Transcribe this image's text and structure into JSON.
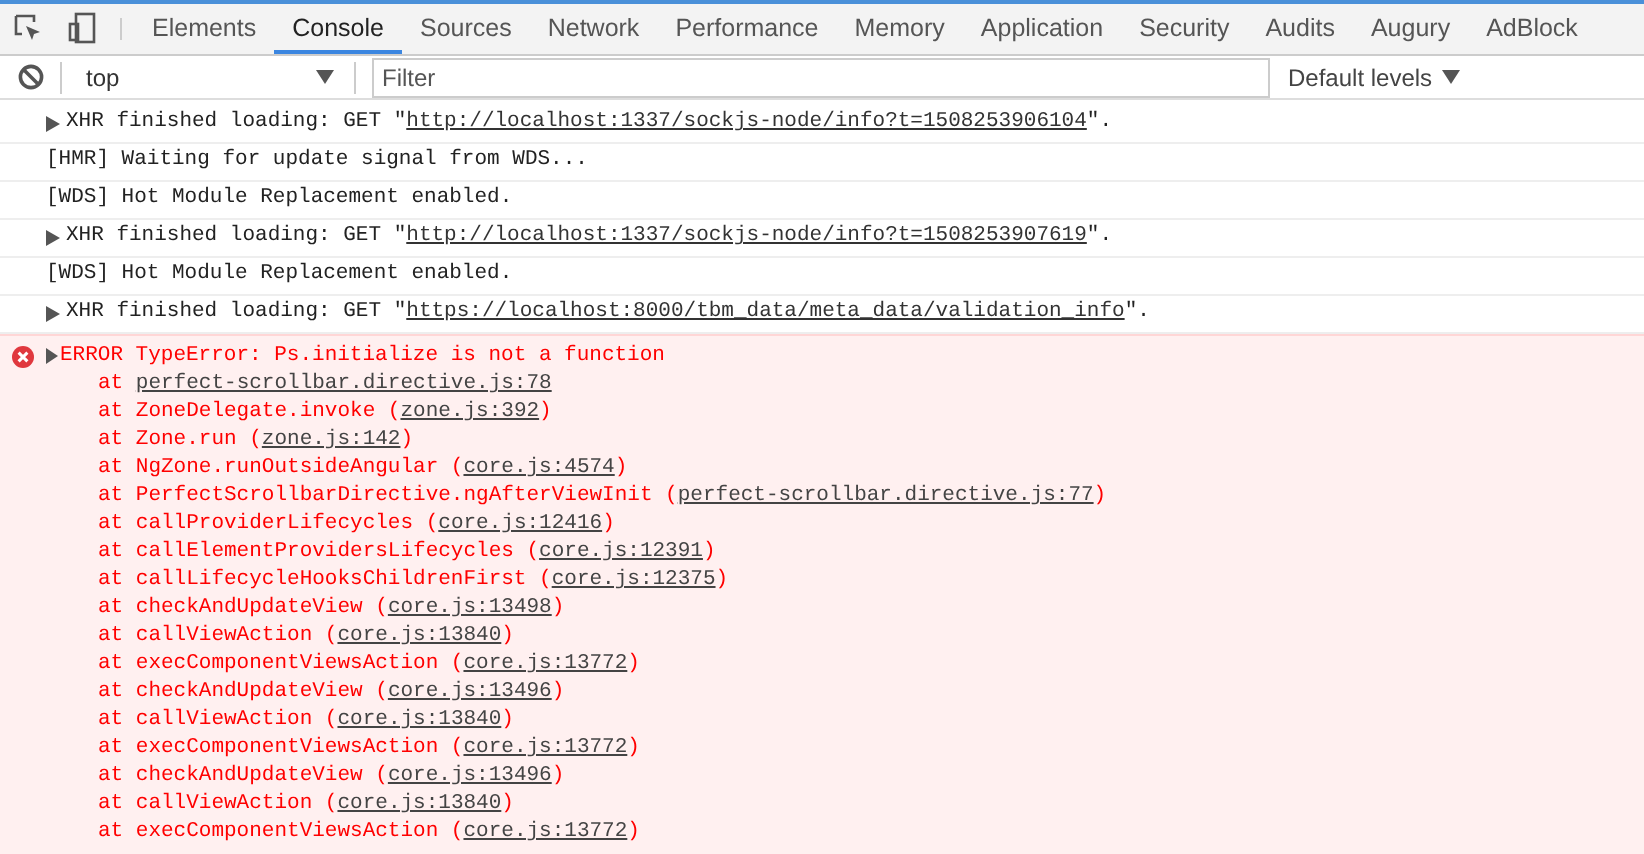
{
  "tabs": [
    {
      "label": "Elements",
      "selected": false
    },
    {
      "label": "Console",
      "selected": true
    },
    {
      "label": "Sources",
      "selected": false
    },
    {
      "label": "Network",
      "selected": false
    },
    {
      "label": "Performance",
      "selected": false
    },
    {
      "label": "Memory",
      "selected": false
    },
    {
      "label": "Application",
      "selected": false
    },
    {
      "label": "Security",
      "selected": false
    },
    {
      "label": "Audits",
      "selected": false
    },
    {
      "label": "Augury",
      "selected": false
    },
    {
      "label": "AdBlock",
      "selected": false
    }
  ],
  "toolbar": {
    "context": "top",
    "filter_placeholder": "Filter",
    "levels": "Default levels"
  },
  "messages": [
    {
      "kind": "xhr",
      "text": "XHR finished loading: GET \"",
      "link": "http://localhost:1337/sockjs-node/info?t=1508253906104",
      "after": "\"."
    },
    {
      "kind": "log",
      "text": "[HMR] Waiting for update signal from WDS..."
    },
    {
      "kind": "log",
      "text": "[WDS] Hot Module Replacement enabled."
    },
    {
      "kind": "xhr",
      "text": "XHR finished loading: GET \"",
      "link": "http://localhost:1337/sockjs-node/info?t=1508253907619",
      "after": "\"."
    },
    {
      "kind": "log",
      "text": "[WDS] Hot Module Replacement enabled."
    },
    {
      "kind": "xhr",
      "text": "XHR finished loading: GET \"",
      "link": "https://localhost:8000/tbm_data/meta_data/validation_info",
      "after": "\"."
    }
  ],
  "error": {
    "message": "ERROR TypeError: Ps.initialize is not a function",
    "stack": [
      {
        "text": "at ",
        "link": "perfect-scrollbar.directive.js:78"
      },
      {
        "text": "at ZoneDelegate.invoke (",
        "link": "zone.js:392",
        "after": ")"
      },
      {
        "text": "at Zone.run (",
        "link": "zone.js:142",
        "after": ")"
      },
      {
        "text": "at NgZone.runOutsideAngular (",
        "link": "core.js:4574",
        "after": ")"
      },
      {
        "text": "at PerfectScrollbarDirective.ngAfterViewInit (",
        "link": "perfect-scrollbar.directive.js:77",
        "after": ")"
      },
      {
        "text": "at callProviderLifecycles (",
        "link": "core.js:12416",
        "after": ")"
      },
      {
        "text": "at callElementProvidersLifecycles (",
        "link": "core.js:12391",
        "after": ")"
      },
      {
        "text": "at callLifecycleHooksChildrenFirst (",
        "link": "core.js:12375",
        "after": ")"
      },
      {
        "text": "at checkAndUpdateView (",
        "link": "core.js:13498",
        "after": ")"
      },
      {
        "text": "at callViewAction (",
        "link": "core.js:13840",
        "after": ")"
      },
      {
        "text": "at execComponentViewsAction (",
        "link": "core.js:13772",
        "after": ")"
      },
      {
        "text": "at checkAndUpdateView (",
        "link": "core.js:13496",
        "after": ")"
      },
      {
        "text": "at callViewAction (",
        "link": "core.js:13840",
        "after": ")"
      },
      {
        "text": "at execComponentViewsAction (",
        "link": "core.js:13772",
        "after": ")"
      },
      {
        "text": "at checkAndUpdateView (",
        "link": "core.js:13496",
        "after": ")"
      },
      {
        "text": "at callViewAction (",
        "link": "core.js:13840",
        "after": ")"
      },
      {
        "text": "at execComponentViewsAction (",
        "link": "core.js:13772",
        "after": ")"
      }
    ]
  }
}
